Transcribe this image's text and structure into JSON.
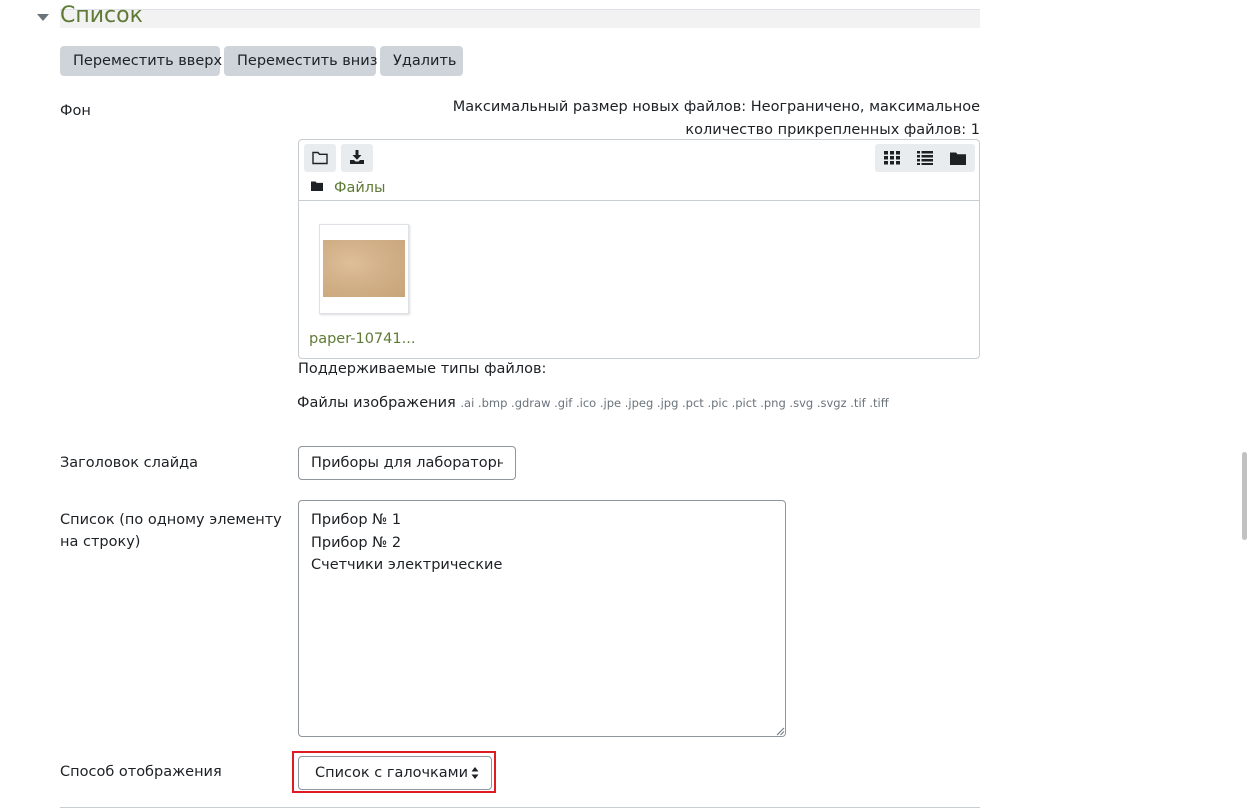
{
  "section": {
    "title": "Список"
  },
  "actions": {
    "move_up": "Переместить вверх",
    "move_down": "Переместить вниз",
    "delete": "Удалить"
  },
  "background": {
    "label": "Фон",
    "limits": "Максимальный размер новых файлов: Неограничено, максимальное количество прикрепленных файлов: 1",
    "path": "Файлы",
    "file_name": "paper-10741...",
    "supported_types_heading": "Поддерживаемые типы файлов:",
    "types_group": "Файлы изображения",
    "types_list": ".ai .bmp .gdraw .gif .ico .jpe .jpeg .jpg .pct .pic .pict .png .svg .svgz .tif .tiff",
    "icons": [
      "folder-icon",
      "download-icon",
      "grid-view-icon",
      "list-view-icon",
      "tree-view-icon",
      "folder-icon"
    ]
  },
  "slide_title": {
    "label": "Заголовок слайда",
    "value": "Приборы для лабораторных"
  },
  "list": {
    "label": "Список (по одному элементу на строку)",
    "items": [
      "Прибор № 1",
      "Прибор № 2",
      "Счетчики электрические"
    ]
  },
  "display_mode": {
    "label": "Способ отображения",
    "selected": "Список с галочками"
  },
  "colors": {
    "accent_link": "#5f7a35",
    "button_bg": "#ced4da",
    "highlight": "#e01b24"
  }
}
